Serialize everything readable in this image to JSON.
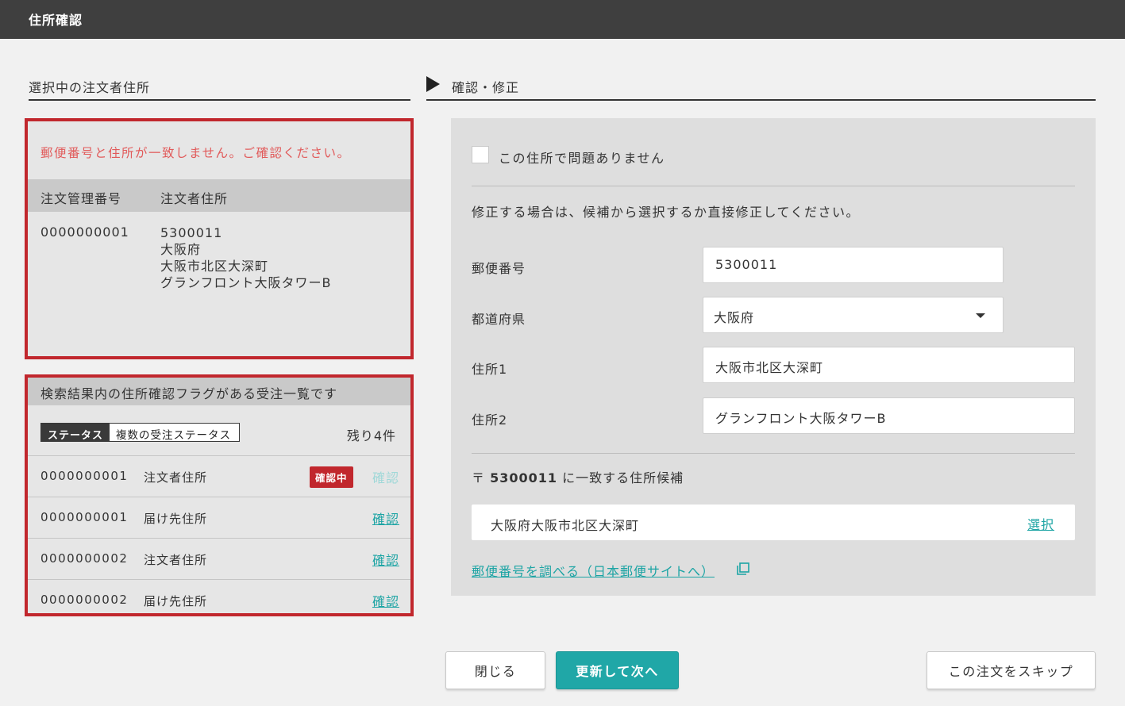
{
  "window": {
    "title": "住所確認"
  },
  "left": {
    "section_title": "選択中の注文者住所",
    "error_message": "郵便番号と住所が一致しません。ご確認ください。",
    "table": {
      "col_id": "注文管理番号",
      "col_addr": "注文者住所",
      "id": "0000000001",
      "address_lines": [
        "5300011",
        "大阪府",
        "大阪市北区大深町",
        "グランフロント大阪タワーB"
      ]
    },
    "list": {
      "heading": "検索結果内の住所確認フラグがある受注一覧です",
      "status_label": "ステータス",
      "status_value": "複数の受注ステータス",
      "remaining": "残り4件",
      "rows": [
        {
          "id": "0000000001",
          "type": "注文者住所",
          "badge": "確認中",
          "link": "確認"
        },
        {
          "id": "0000000001",
          "type": "届け先住所",
          "badge": "",
          "link": "確認"
        },
        {
          "id": "0000000002",
          "type": "注文者住所",
          "badge": "",
          "link": "確認"
        },
        {
          "id": "0000000002",
          "type": "届け先住所",
          "badge": "",
          "link": "確認"
        }
      ]
    }
  },
  "right": {
    "section_title": "確認・修正",
    "checkbox_label": "この住所で問題ありません",
    "instruction": "修正する場合は、候補から選択するか直接修正してください。",
    "fields": {
      "postal_label": "郵便番号",
      "postal_value": "5300011",
      "pref_label": "都道府県",
      "pref_value": "大阪府",
      "addr1_label": "住所1",
      "addr1_value": "大阪市北区大深町",
      "addr2_label": "住所2",
      "addr2_value": "グランフロント大阪タワーB"
    },
    "candidates": {
      "prefix": "〒",
      "postal": "5300011",
      "suffix": "に一致する住所候補",
      "address": "大阪府大阪市北区大深町",
      "select_label": "選択"
    },
    "lookup_link": "郵便番号を調べる（日本郵便サイトへ）"
  },
  "buttons": {
    "close": "閉じる",
    "update_next": "更新して次へ",
    "skip": "この注文をスキップ"
  },
  "colors": {
    "accent": "#20a7a7",
    "error": "#c1272d",
    "link": "#1ca4a4"
  }
}
